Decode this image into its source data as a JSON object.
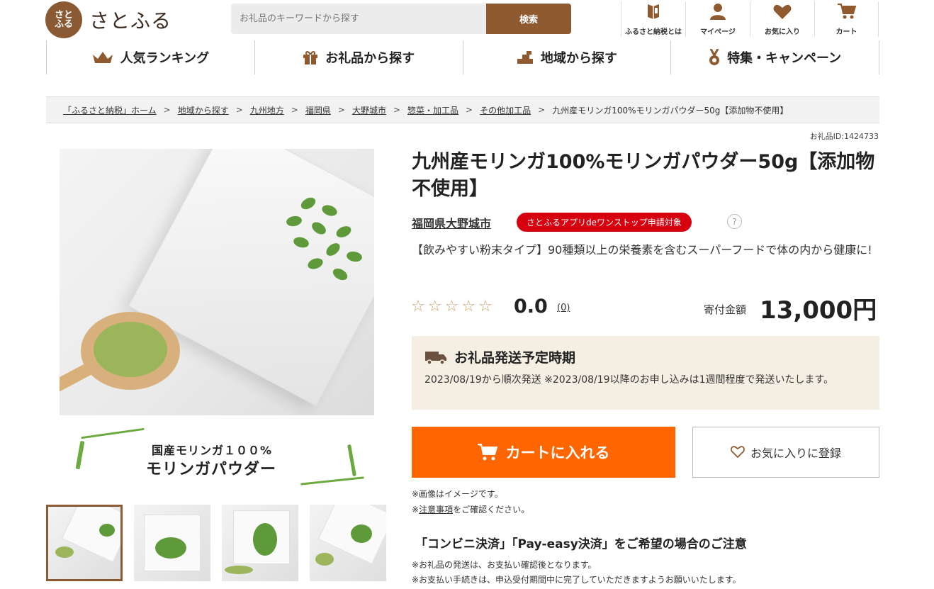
{
  "header": {
    "logo_mark": "さとふる",
    "logo_text": "さとふる",
    "search_placeholder": "お礼品のキーワードから探す",
    "search_button": "検索",
    "icons": [
      {
        "label": "ふるさと納税とは",
        "icon": "book-icon"
      },
      {
        "label": "マイページ",
        "icon": "user-icon"
      },
      {
        "label": "お気に入り",
        "icon": "heart-icon"
      },
      {
        "label": "カート",
        "icon": "cart-icon"
      }
    ]
  },
  "nav": [
    {
      "label": "人気ランキング",
      "icon": "crown-icon"
    },
    {
      "label": "お礼品から探す",
      "icon": "gift-icon"
    },
    {
      "label": "地域から探す",
      "icon": "map-icon"
    },
    {
      "label": "特集・キャンペーン",
      "icon": "medal-icon"
    }
  ],
  "breadcrumb": {
    "links": [
      "「ふるさと納税」ホーム",
      "地域から探す",
      "九州地方",
      "福岡県",
      "大野城市",
      "惣菜・加工品",
      "その他加工品"
    ],
    "current": "九州産モリンガ100%モリンガパウダー50g【添加物不使用】"
  },
  "product": {
    "item_id": "お礼品ID:1424733",
    "title": "九州産モリンガ100%モリンガパウダー50g【添加物不使用】",
    "city": "福岡県大野城市",
    "badge": "さとふるアプリdeワンストップ申請対象",
    "help": "?",
    "description": "【飲みやすい粉末タイプ】90種類以上の栄養素を含むスーパーフードで体の内から健康に!",
    "rating": "0.0",
    "rating_value": 0,
    "rating_max": 5,
    "review_count": "(0)",
    "price_label": "寄付金額",
    "price": "13,000円"
  },
  "image": {
    "banner_line1": "国産モリンガ１００%",
    "banner_line2": "モリンガパウダー"
  },
  "shipping": {
    "title": "お礼品発送予定時期",
    "text": "2023/08/19から順次発送 ※2023/08/19以降のお申し込みは1週間程度で発送いたします。"
  },
  "actions": {
    "cart": "カートに入れる",
    "favorite": "お気に入りに登録"
  },
  "notes": {
    "image_note": "※画像はイメージです。",
    "caution_prefix": "※",
    "caution_link": "注意事項",
    "caution_suffix": "をご確認ください。",
    "convenience_title": "「コンビニ決済」「Pay-easy決済」をご希望の場合のご注意",
    "convenience_note1": "※お礼品の発送は、お支払い確認後となります。",
    "convenience_note2": "※お支払い手続きは、申込受付期間中に完了していただきますようお願いいたします。"
  },
  "colors": {
    "brand_brown": "#8f5a2f",
    "cart_orange": "#ff6600",
    "badge_red": "#d6000f",
    "shipping_bg": "#f5efe3"
  }
}
